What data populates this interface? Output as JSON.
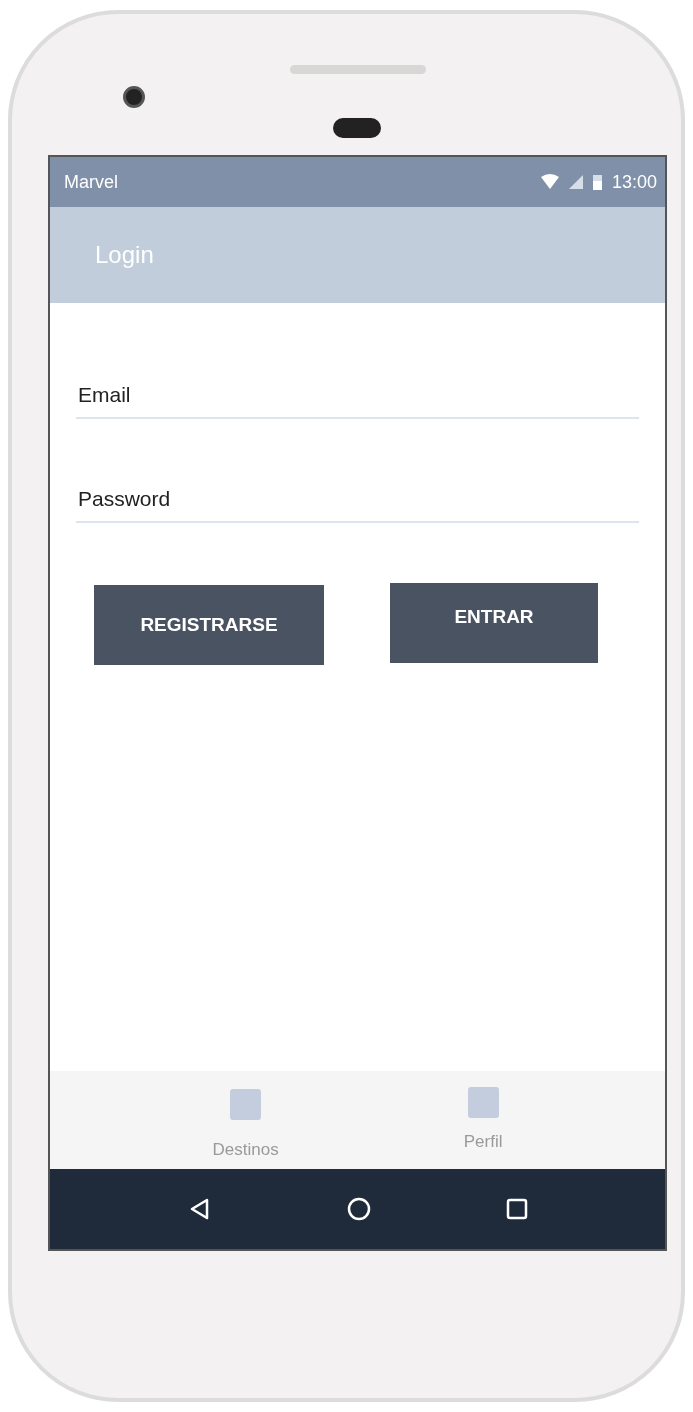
{
  "status_bar": {
    "carrier": "Marvel",
    "time": "13:00"
  },
  "app_bar": {
    "title": "Login"
  },
  "fields": [
    {
      "placeholder": "Email"
    },
    {
      "placeholder": "Password"
    }
  ],
  "buttons": [
    {
      "label": "REGISTRARSE"
    },
    {
      "label": "ENTRAR"
    }
  ],
  "bottom_nav": [
    {
      "label": "Destinos"
    },
    {
      "label": "Perfil"
    }
  ]
}
